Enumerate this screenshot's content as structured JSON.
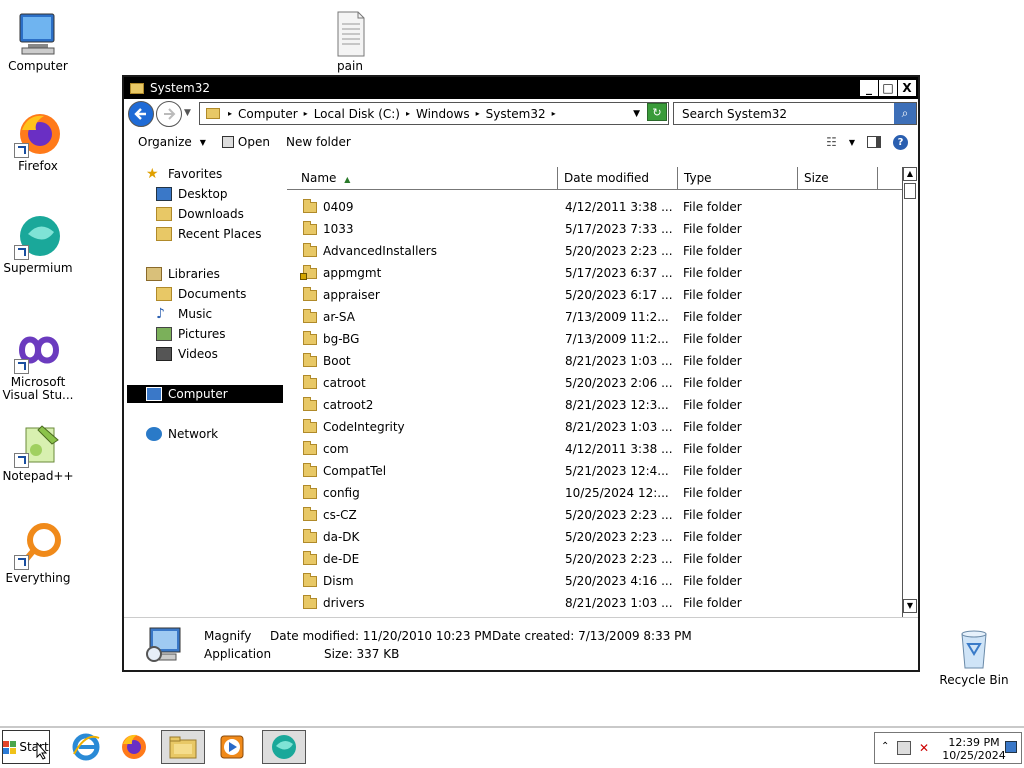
{
  "desktop": {
    "icons": [
      {
        "label": "Computer"
      },
      {
        "label": "pain"
      },
      {
        "label": "Firefox"
      },
      {
        "label": "Supermium"
      },
      {
        "label": "Microsoft Visual Stu..."
      },
      {
        "label": "Notepad++"
      },
      {
        "label": "Everything"
      },
      {
        "label": "Recycle Bin"
      }
    ]
  },
  "window": {
    "title": "System32",
    "buttons": {
      "minimize": "_",
      "maximize": "□",
      "close": "X"
    },
    "address": {
      "crumbs": [
        "Computer",
        "Local Disk (C:)",
        "Windows",
        "System32"
      ]
    },
    "search": {
      "placeholder": "Search System32"
    },
    "toolbar": {
      "organize": "Organize",
      "open": "Open",
      "new_folder": "New folder"
    },
    "nav": {
      "favorites": "Favorites",
      "desktop": "Desktop",
      "downloads": "Downloads",
      "recent": "Recent Places",
      "libraries": "Libraries",
      "documents": "Documents",
      "music": "Music",
      "pictures": "Pictures",
      "videos": "Videos",
      "computer": "Computer",
      "network": "Network"
    },
    "columns": {
      "name": "Name",
      "date": "Date modified",
      "type": "Type",
      "size": "Size"
    },
    "files": [
      {
        "name": "0409",
        "date": "4/12/2011 3:38 ...",
        "type": "File folder"
      },
      {
        "name": "1033",
        "date": "5/17/2023 7:33 ...",
        "type": "File folder"
      },
      {
        "name": "AdvancedInstallers",
        "date": "5/20/2023 2:23 ...",
        "type": "File folder"
      },
      {
        "name": "appmgmt",
        "date": "5/17/2023 6:37 ...",
        "type": "File folder"
      },
      {
        "name": "appraiser",
        "date": "5/20/2023 6:17 ...",
        "type": "File folder"
      },
      {
        "name": "ar-SA",
        "date": "7/13/2009 11:2...",
        "type": "File folder"
      },
      {
        "name": "bg-BG",
        "date": "7/13/2009 11:2...",
        "type": "File folder"
      },
      {
        "name": "Boot",
        "date": "8/21/2023 1:03 ...",
        "type": "File folder"
      },
      {
        "name": "catroot",
        "date": "5/20/2023 2:06 ...",
        "type": "File folder"
      },
      {
        "name": "catroot2",
        "date": "8/21/2023 12:3...",
        "type": "File folder"
      },
      {
        "name": "CodeIntegrity",
        "date": "8/21/2023 1:03 ...",
        "type": "File folder"
      },
      {
        "name": "com",
        "date": "4/12/2011 3:38 ...",
        "type": "File folder"
      },
      {
        "name": "CompatTel",
        "date": "5/21/2023 12:4...",
        "type": "File folder"
      },
      {
        "name": "config",
        "date": "10/25/2024 12:...",
        "type": "File folder"
      },
      {
        "name": "cs-CZ",
        "date": "5/20/2023 2:23 ...",
        "type": "File folder"
      },
      {
        "name": "da-DK",
        "date": "5/20/2023 2:23 ...",
        "type": "File folder"
      },
      {
        "name": "de-DE",
        "date": "5/20/2023 2:23 ...",
        "type": "File folder"
      },
      {
        "name": "Dism",
        "date": "5/20/2023 4:16 ...",
        "type": "File folder"
      },
      {
        "name": "drivers",
        "date": "8/21/2023 1:03 ...",
        "type": "File folder"
      }
    ],
    "details": {
      "name": "Magnify",
      "kind": "Application",
      "date_modified": "Date modified: 11/20/2010 10:23 PM",
      "date_created": "Date created: 7/13/2009 8:33 PM",
      "size": "Size: 337 KB"
    }
  },
  "taskbar": {
    "start": "Start",
    "clock_time": "12:39 PM",
    "clock_date": "10/25/2024"
  }
}
